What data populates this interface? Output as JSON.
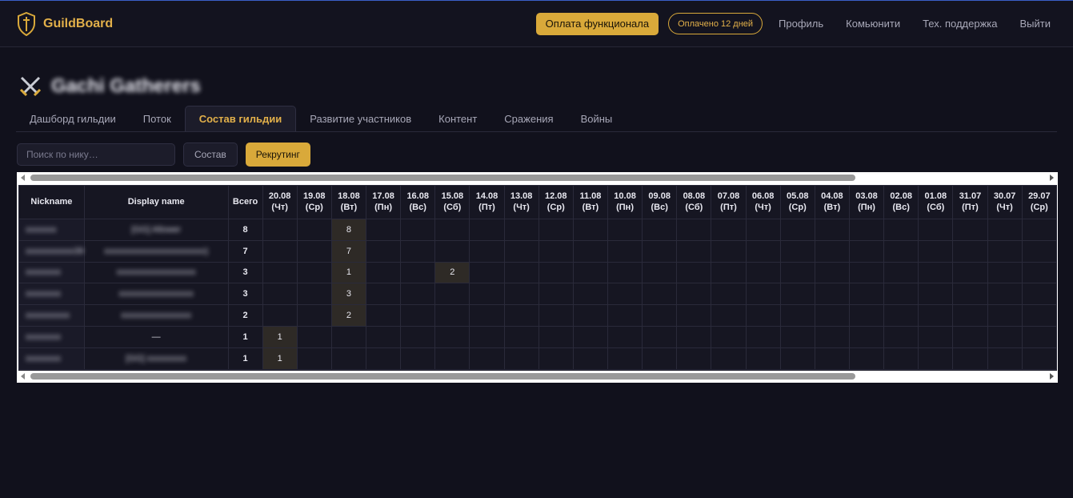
{
  "header": {
    "brand": "GuildBoard",
    "pay_button": "Оплата функционала",
    "paid_badge": "Оплачено 12 дней",
    "nav": [
      "Профиль",
      "Комьюнити",
      "Тех. поддержка",
      "Выйти"
    ]
  },
  "guild": {
    "name": "Gachi Gatherers"
  },
  "tabs": [
    {
      "label": "Дашборд гильдии",
      "active": false
    },
    {
      "label": "Поток",
      "active": false
    },
    {
      "label": "Состав гильдии",
      "active": true
    },
    {
      "label": "Развитие участников",
      "active": false
    },
    {
      "label": "Контент",
      "active": false
    },
    {
      "label": "Сражения",
      "active": false
    },
    {
      "label": "Войны",
      "active": false
    }
  ],
  "controls": {
    "search_placeholder": "Поиск по нику…",
    "sostav_button": "Состав",
    "recruit_button": "Рекрутинг"
  },
  "table": {
    "headers": {
      "nickname": "Nickname",
      "display_name": "Display name",
      "total": "Всего"
    },
    "dates": [
      {
        "date": "20.08",
        "day": "(Чт)"
      },
      {
        "date": "19.08",
        "day": "(Ср)"
      },
      {
        "date": "18.08",
        "day": "(Вт)"
      },
      {
        "date": "17.08",
        "day": "(Пн)"
      },
      {
        "date": "16.08",
        "day": "(Вс)"
      },
      {
        "date": "15.08",
        "day": "(Сб)"
      },
      {
        "date": "14.08",
        "day": "(Пт)"
      },
      {
        "date": "13.08",
        "day": "(Чт)"
      },
      {
        "date": "12.08",
        "day": "(Ср)"
      },
      {
        "date": "11.08",
        "day": "(Вт)"
      },
      {
        "date": "10.08",
        "day": "(Пн)"
      },
      {
        "date": "09.08",
        "day": "(Вс)"
      },
      {
        "date": "08.08",
        "day": "(Сб)"
      },
      {
        "date": "07.08",
        "day": "(Пт)"
      },
      {
        "date": "06.08",
        "day": "(Чт)"
      },
      {
        "date": "05.08",
        "day": "(Ср)"
      },
      {
        "date": "04.08",
        "day": "(Вт)"
      },
      {
        "date": "03.08",
        "day": "(Пн)"
      },
      {
        "date": "02.08",
        "day": "(Вс)"
      },
      {
        "date": "01.08",
        "day": "(Сб)"
      },
      {
        "date": "31.07",
        "day": "(Пт)"
      },
      {
        "date": "30.07",
        "day": "(Чт)"
      },
      {
        "date": "29.07",
        "day": "(Ср)"
      }
    ],
    "rows": [
      {
        "nickname": "xxxxxxx",
        "display_name": "[GG] Allower",
        "total": "8",
        "cells": {
          "2": "8"
        }
      },
      {
        "nickname": "xxxxxxxxxxx39",
        "display_name": "xxxxxxxxxxxxxxxxxxxxxxx)",
        "total": "7",
        "cells": {
          "2": "7"
        }
      },
      {
        "nickname": "xxxxxxxx",
        "display_name": "xxxxxxxxxxxxxxxxxx",
        "total": "3",
        "cells": {
          "2": "1",
          "5": "2"
        }
      },
      {
        "nickname": "xxxxxxxx",
        "display_name": "xxxxxxxxxxxxxxxxx",
        "total": "3",
        "cells": {
          "2": "3"
        }
      },
      {
        "nickname": "xxxxxxxxxx",
        "display_name": "xxxxxxxxxxxxxxxx",
        "total": "2",
        "cells": {
          "2": "2"
        }
      },
      {
        "nickname": "xxxxxxxx",
        "display_name": "—",
        "total": "1",
        "cells": {
          "0": "1"
        }
      },
      {
        "nickname": "xxxxxxxx",
        "display_name": "[GG] xxxxxxxxx",
        "total": "1",
        "cells": {
          "0": "1"
        }
      }
    ]
  }
}
